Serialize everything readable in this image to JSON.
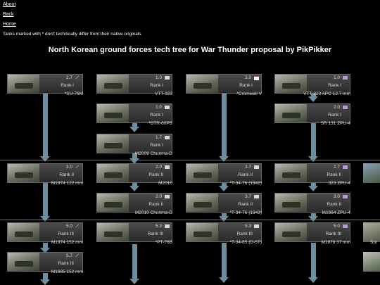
{
  "nav": {
    "about": "About",
    "back": "Back",
    "home": "Home"
  },
  "note": "Tanks marked with * don't technically differ from their native originals",
  "title": "North Korean ground forces tech tree for War Thunder proposal by PikPikker",
  "cards": [
    {
      "br": "2.7",
      "rank": "Rank I",
      "name": "*SU-76M",
      "icon": "pencil-icon"
    },
    {
      "br": "1.0",
      "rank": "Rank I",
      "name": "VTT-323",
      "icon": "flag-icon"
    },
    {
      "br": "3.0",
      "rank": "Rank I",
      "name": "*Cromwell V",
      "icon": "flag-icon"
    },
    {
      "br": "1.0",
      "rank": "Rank I",
      "name": "VTT-323 APC 12.7 mm",
      "icon": "aa-icon"
    },
    {
      "br": "1.0",
      "rank": "Rank I",
      "name": "*BTR-60PB",
      "icon": "flag-icon"
    },
    {
      "br": "2.0",
      "rank": "Rank I",
      "name": "SR 131 ZPU-4",
      "icon": "aa-icon"
    },
    {
      "br": "1.7",
      "rank": "Rank I",
      "name": "M2009 Chunma-D",
      "icon": "flag-icon"
    },
    {
      "br": "3.0",
      "rank": "Rank II",
      "name": "M1974 122 mm",
      "icon": "pencil-icon"
    },
    {
      "br": "2.0",
      "rank": "Rank II",
      "name": "M2010",
      "icon": "flag-icon"
    },
    {
      "br": "3.7",
      "rank": "Rank II",
      "name": "*T-34-76 (1942)",
      "icon": "flag-icon"
    },
    {
      "br": "2.7",
      "rank": "Rank II",
      "name": "323 ZPU-4",
      "icon": "aa-icon"
    },
    {
      "br": "2.0",
      "rank": "Rank II",
      "name": "M2010 Chunma-D",
      "icon": "flag-icon"
    },
    {
      "br": "3.7",
      "rank": "Rank II",
      "name": "*T-34-76 (1943)",
      "icon": "flag-icon"
    },
    {
      "br": "3.0",
      "rank": "Rank II",
      "name": "M1984 ZPU-4",
      "icon": "aa-icon"
    },
    {
      "br": "5.0",
      "rank": "Rank III",
      "name": "M1974 152 mm",
      "icon": "pencil-icon"
    },
    {
      "br": "5.3",
      "rank": "Rank III",
      "name": "*PT-76B",
      "icon": "flag-icon"
    },
    {
      "br": "5.3",
      "rank": "Rank III",
      "name": "*T-34-85 (D-5T)",
      "icon": "flag-icon"
    },
    {
      "br": "5.0",
      "rank": "Rank III",
      "name": "M1978 37 mm",
      "icon": "aa-icon"
    },
    {
      "br": "5.7",
      "rank": "Rank III",
      "name": "M1985 152 mm",
      "icon": "pencil-icon"
    }
  ],
  "partial": {
    "name_a": "Sur"
  }
}
